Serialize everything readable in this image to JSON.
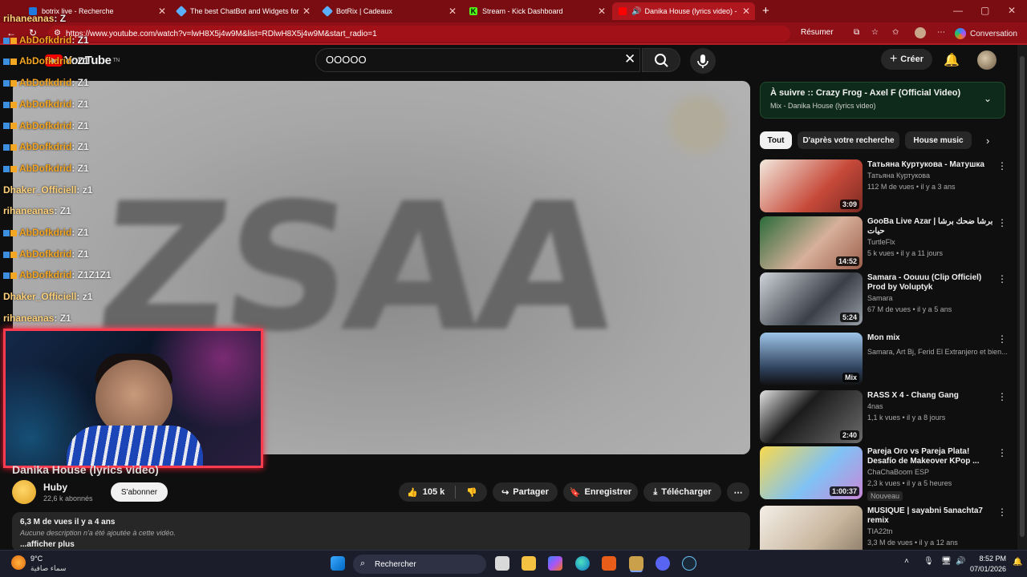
{
  "browser": {
    "tabs": [
      {
        "title": "botrix live - Recherche",
        "icon": "bing-icon"
      },
      {
        "title": "The best ChatBot and Widgets for",
        "icon": "botrix-icon"
      },
      {
        "title": "BotRix | Cadeaux",
        "icon": "botrix-icon"
      },
      {
        "title": "Stream - Kick Dashboard",
        "icon": "kick-icon"
      },
      {
        "title": "Danika House (lyrics video) -",
        "icon": "youtube-icon",
        "active": true
      }
    ],
    "url": "https://www.youtube.com/watch?v=lwH8X5j4w9M&list=RDlwH8X5j4w9M&start_radio=1",
    "resume_label": "Résumer",
    "conversation_label": "Conversation"
  },
  "youtube": {
    "logo_text": "YouTube",
    "logo_sup": "TN",
    "search_value": "OOOOO",
    "create_label": "Créer"
  },
  "chat": [
    {
      "user": "rihaneanas",
      "msg": ": Z"
    },
    {
      "user": "AbDofkdrid",
      "msg": ": Z1"
    },
    {
      "user": "AbDofkdrid",
      "msg": ": Z1"
    },
    {
      "user": "AbDofkdrid",
      "msg": ": Z1"
    },
    {
      "user": "AbDofkdrid",
      "msg": ": Z1"
    },
    {
      "user": "AbDofkdrid",
      "msg": ": Z1"
    },
    {
      "user": "AbDofkdrid",
      "msg": ": Z1"
    },
    {
      "user": "AbDofkdrid",
      "msg": ": Z1"
    },
    {
      "user": "Dhaker_Officiell",
      "msg": ": z1"
    },
    {
      "user": "rihaneanas",
      "msg": ": Z1"
    },
    {
      "user": "AbDofkdrid",
      "msg": ": Z1"
    },
    {
      "user": "AbDofkdrid",
      "msg": ": Z1"
    },
    {
      "user": "AbDofkdrid",
      "msg": ": Z1Z1Z1"
    },
    {
      "user": "Dhaker_Officiell",
      "msg": ": z1"
    },
    {
      "user": "rihaneanas",
      "msg": ": Z1"
    }
  ],
  "video": {
    "title": "Danika House (lyrics video)",
    "frame_text": "ZSAA",
    "channel": "Huby",
    "subscribers": "22,6 k abonnés",
    "subscribe_label": "S'abonner",
    "likes": "105 k",
    "share_label": "Partager",
    "save_label": "Enregistrer",
    "download_label": "Télécharger",
    "stats": "6,3 M de vues  il y a 4 ans",
    "description": "Aucune description n'a été ajoutée à cette vidéo.",
    "more_label": "...afficher plus"
  },
  "sidebar": {
    "up_next_title": "À suivre :: Crazy Frog - Axel F (Official Video)",
    "up_next_sub": "Mix - Danika House (lyrics video)",
    "chips": [
      "Tout",
      "D'après votre recherche",
      "House music"
    ],
    "items": [
      {
        "title": "Татьяна Куртукова - Матушка",
        "channel": "Татьяна Куртукова",
        "meta": "112 M de vues • il y a 3 ans",
        "duration": "3:09"
      },
      {
        "title": "GooBa Live Azar | برشا ضحك برشا حيات",
        "channel": "TurtleFlx",
        "meta": "5 k vues • il y a 11 jours",
        "duration": "14:52"
      },
      {
        "title": "Samara - Oouuu (Clip Officiel) Prod by Voluptyk",
        "channel": "Samara",
        "meta": "67 M de vues • il y a 5 ans",
        "duration": "5:24"
      },
      {
        "title": "Mon mix",
        "channel": "Samara, Art Bj, Ferid El Extranjero et bien...",
        "meta": "",
        "duration": "Mix"
      },
      {
        "title": "RASS X 4 - Chang Gang",
        "channel": "4nas",
        "meta": "1,1 k vues • il y a 8 jours",
        "duration": "2:40"
      },
      {
        "title": "Pareja Oro vs Pareja Plata! Desafío de Makeover KPop ...",
        "channel": "ChaChaBoom ESP",
        "meta": "2,3 k vues • il y a 5 heures",
        "duration": "1:00:37",
        "badge": "Nouveau"
      },
      {
        "title": "MUSIQUE | sayabni 5anachta7 remix",
        "channel": "TIA22tn",
        "meta": "3,3 M de vues • il y a 12 ans",
        "duration": ""
      }
    ]
  },
  "taskbar": {
    "temp": "9°C",
    "weather": "سماء صافية",
    "search_label": "Rechercher",
    "time": "8:52 PM",
    "date": "07/01/2026"
  }
}
